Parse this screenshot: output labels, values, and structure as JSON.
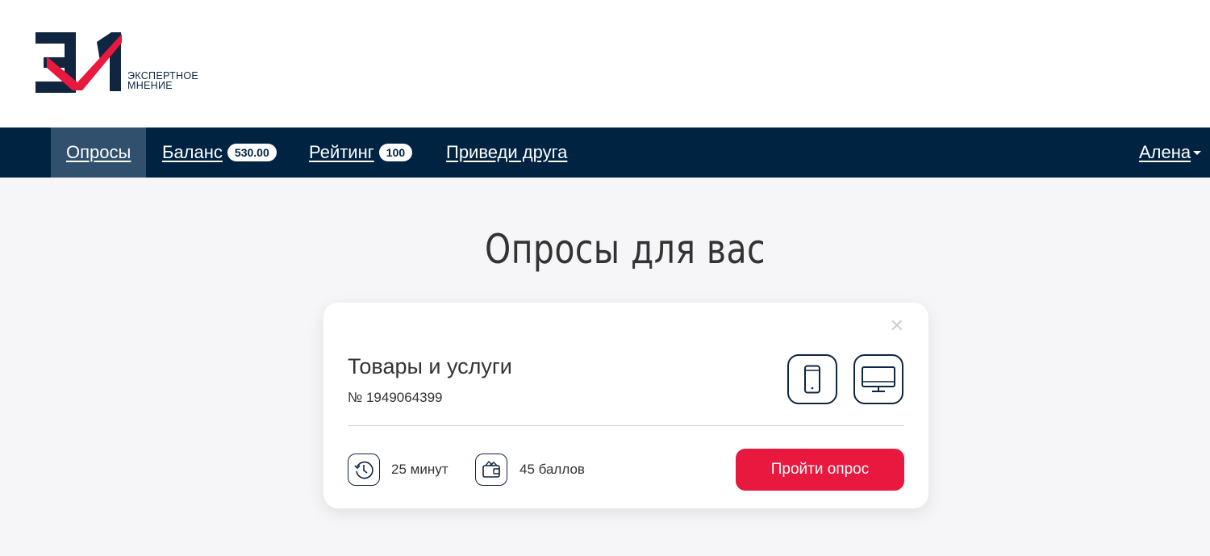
{
  "brand": {
    "logo_line1": "ЭКСПЕРТНОЕ",
    "logo_line2": "МНЕНИЕ",
    "colors": {
      "navy": "#0f2540",
      "red": "#e8183e"
    }
  },
  "nav": {
    "items": [
      {
        "label": "Опросы",
        "active": true
      },
      {
        "label": "Баланс",
        "badge": "530.00"
      },
      {
        "label": "Рейтинг",
        "badge": "100"
      },
      {
        "label": "Приведи друга"
      }
    ],
    "user": "Алена",
    "background": "#002341",
    "active_background": "#31506e"
  },
  "main": {
    "title": "Опросы для вас"
  },
  "survey": {
    "title": "Товары и услуги",
    "number": "№ 1949064399",
    "close_icon": "close-icon",
    "devices": [
      "smartphone-icon",
      "monitor-icon"
    ],
    "duration": "25 минут",
    "reward": "45 баллов",
    "button_label": "Пройти опрос"
  }
}
